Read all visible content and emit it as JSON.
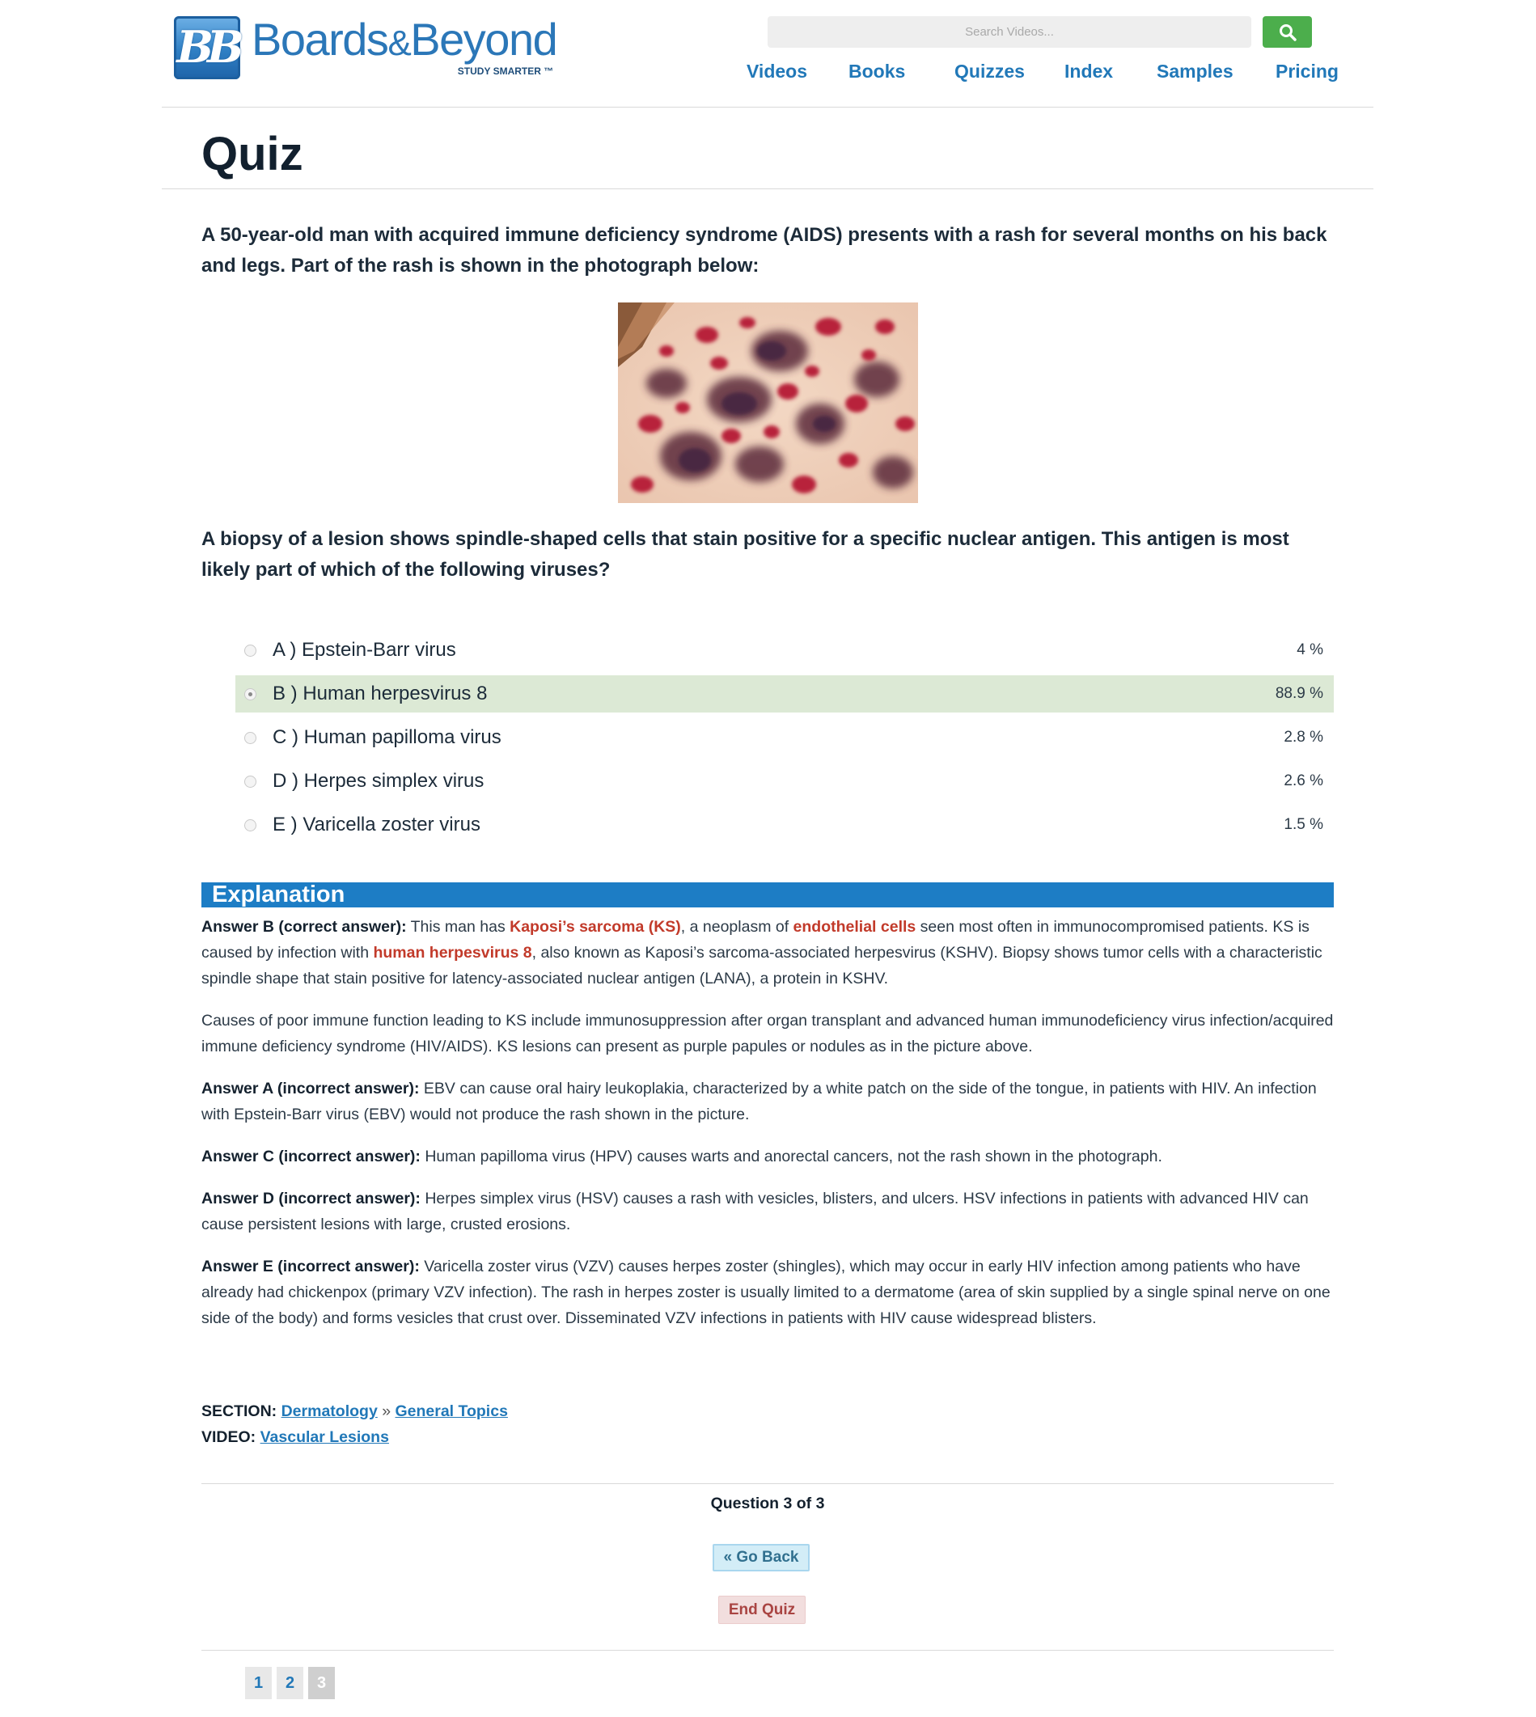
{
  "header": {
    "logo_name": "Boards&Beyond",
    "logo_name_part1": "Boards",
    "logo_name_amp": "&",
    "logo_name_part2": "Beyond",
    "logo_tagline": "STUDY SMARTER ™",
    "search_placeholder": "Search Videos...",
    "search_icon": "search-icon",
    "nav": [
      "Videos",
      "Books",
      "Quizzes",
      "Index",
      "Samples",
      "Pricing"
    ]
  },
  "page_title": "Quiz",
  "question": {
    "stem": "A 50-year-old man with acquired immune deficiency syndrome (AIDS) presents with a rash for several months on his back and legs. Part of the rash is shown in the photograph below:",
    "prompt": "A biopsy of a lesion shows spindle-shaped cells that stain positive for a specific nuclear antigen. This antigen is most likely part of which of the following viruses?"
  },
  "choices": [
    {
      "label": "A ) Epstein-Barr virus",
      "pct": "4 %",
      "selected": false
    },
    {
      "label": "B ) Human herpesvirus 8",
      "pct": "88.9 %",
      "selected": true
    },
    {
      "label": "C ) Human papilloma virus",
      "pct": "2.8 %",
      "selected": false
    },
    {
      "label": "D ) Herpes simplex virus",
      "pct": "2.6 %",
      "selected": false
    },
    {
      "label": "E ) Varicella zoster virus",
      "pct": "1.5 %",
      "selected": false
    }
  ],
  "explanation": {
    "heading": "Explanation",
    "p1": {
      "lead": "Answer B (correct answer):",
      "t1": " This man has ",
      "h1": "Kaposi’s sarcoma (KS)",
      "t2": ", a neoplasm of ",
      "h2": "endothelial cells",
      "t3": " seen most often in immunocompromised patients. KS is caused by infection with ",
      "h3": "human herpesvirus 8",
      "t4": ", also known as Kaposi’s sarcoma-associated herpesvirus (KSHV). Biopsy shows tumor cells with a characteristic spindle shape that stain positive for latency-associated nuclear antigen (LANA), a protein in KSHV."
    },
    "p2": "Causes of poor immune function leading to KS include immunosuppression after organ transplant and advanced human immunodeficiency virus infection/acquired immune deficiency syndrome (HIV/AIDS). KS lesions can present as purple papules or nodules as in the picture above.",
    "p3": {
      "lead": "Answer A (incorrect answer):",
      "text": " EBV can cause oral hairy leukoplakia, characterized by a white patch on the side of the tongue, in patients with HIV. An infection with Epstein-Barr virus (EBV) would not produce the rash shown in the picture."
    },
    "p4": {
      "lead": "Answer C (incorrect answer):",
      "text": " Human papilloma virus (HPV) causes warts and anorectal cancers, not the rash shown in the photograph."
    },
    "p5": {
      "lead": "Answer D (incorrect answer):",
      "text": " Herpes simplex virus (HSV) causes a rash with vesicles, blisters, and ulcers. HSV infections in patients with advanced HIV can cause persistent lesions with large, crusted erosions."
    },
    "p6": {
      "lead": "Answer E (incorrect answer):",
      "text": " Varicella zoster virus (VZV) causes herpes zoster (shingles), which may occur in early HIV infection among patients who have already had chickenpox (primary VZV infection). The rash in herpes zoster is usually limited to a dermatome (area of skin supplied by a single spinal nerve on one side of the body) and forms vesicles that crust over. Disseminated VZV infections in patients with HIV cause widespread blisters."
    }
  },
  "meta": {
    "section_label": "SECTION:",
    "section_link": "Dermatology",
    "section_sep": " » ",
    "subsection_link": "General Topics",
    "video_label": "VIDEO:",
    "video_link": "Vascular Lesions"
  },
  "footer": {
    "question_count": "Question 3 of 3",
    "go_back": "« Go Back",
    "end_quiz": "End Quiz",
    "pages": [
      "1",
      "2",
      "3"
    ],
    "current_page": "3"
  },
  "colors": {
    "brand_blue": "#2178b8",
    "explanation_bar": "#1d7dc5",
    "highlight_red": "#c23a2a",
    "selected_row": "#dce9d5",
    "search_green": "#4cae4c"
  }
}
